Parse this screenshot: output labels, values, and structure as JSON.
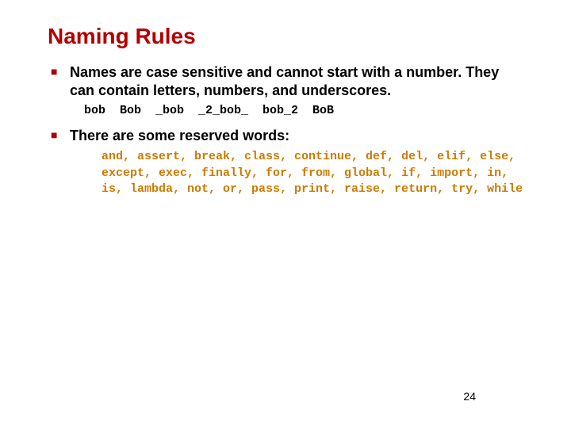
{
  "title": "Naming Rules",
  "bullets": [
    {
      "text": "Names are case sensitive and cannot start with a number. They can contain letters, numbers, and underscores.",
      "examples": "bob  Bob  _bob  _2_bob_  bob_2  BoB"
    },
    {
      "text": "There are some reserved words:",
      "reserved": "and, assert, break, class, continue, def, del, elif, else, except, exec, finally, for, from, global, if, import, in, is, lambda, not, or, pass, print, raise, return, try, while"
    }
  ],
  "page_number": "24"
}
